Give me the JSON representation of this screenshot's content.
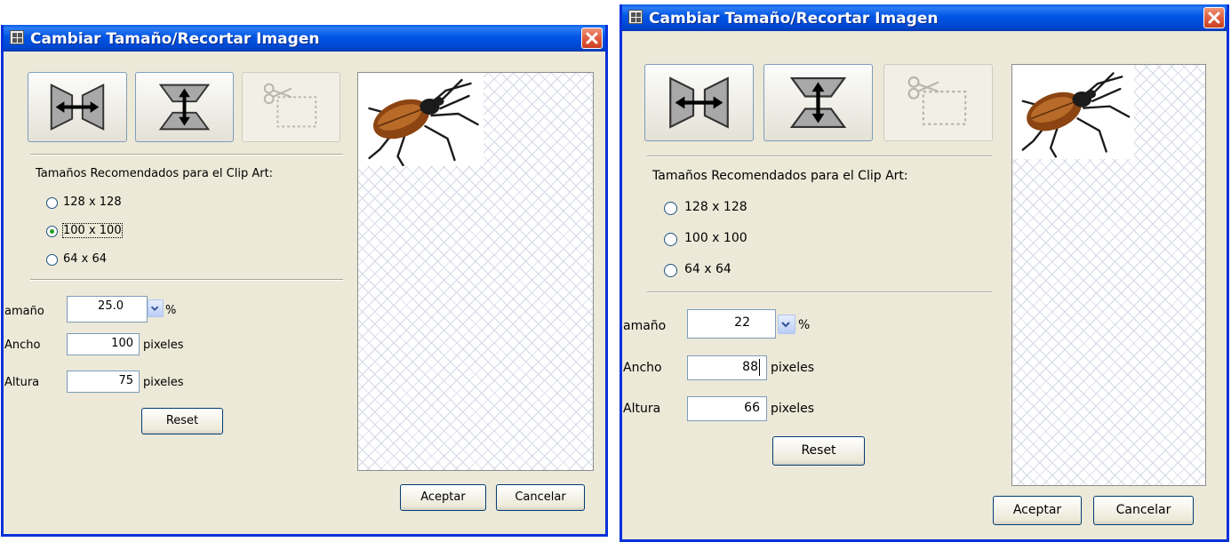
{
  "dialogs": [
    {
      "title": "Cambiar Tamaño/Recortar Imagen",
      "section_label": "Tamaños Recomendados para el Clip Art:",
      "sizes": [
        {
          "label": "128 x 128",
          "selected": false
        },
        {
          "label": "100 x 100",
          "selected": true
        },
        {
          "label": "64 x 64",
          "selected": false
        }
      ],
      "size_label": "amaño",
      "size_value": "25.0",
      "percent_label": "%",
      "width_label": "Ancho",
      "width_value": "100",
      "height_label": "Altura",
      "height_value": "75",
      "pixels_label": "pixeles",
      "reset_label": "Reset",
      "accept_label": "Aceptar",
      "cancel_label": "Cancelar"
    },
    {
      "title": "Cambiar Tamaño/Recortar Imagen",
      "section_label": "Tamaños Recomendados para el Clip Art:",
      "sizes": [
        {
          "label": "128 x 128",
          "selected": false
        },
        {
          "label": "100 x 100",
          "selected": false
        },
        {
          "label": "64 x 64",
          "selected": false
        }
      ],
      "size_label": "amaño",
      "size_value": "22",
      "percent_label": "%",
      "width_label": "Ancho",
      "width_value": "88",
      "height_label": "Altura",
      "height_value": "66",
      "pixels_label": "pixeles",
      "reset_label": "Reset",
      "accept_label": "Aceptar",
      "cancel_label": "Cancelar"
    }
  ],
  "icons": {
    "app": "app-icon",
    "close": "close-icon",
    "tool_width": "resize-width-icon",
    "tool_height": "resize-height-icon",
    "tool_crop": "crop-scissors-icon",
    "combo": "chevron-down-icon"
  },
  "colors": {
    "titlebar": "#0055e5",
    "dialog_bg": "#ece9d8",
    "close": "#de5a3b",
    "radio_selected": "#21a121",
    "field_border": "#7f9db9"
  }
}
